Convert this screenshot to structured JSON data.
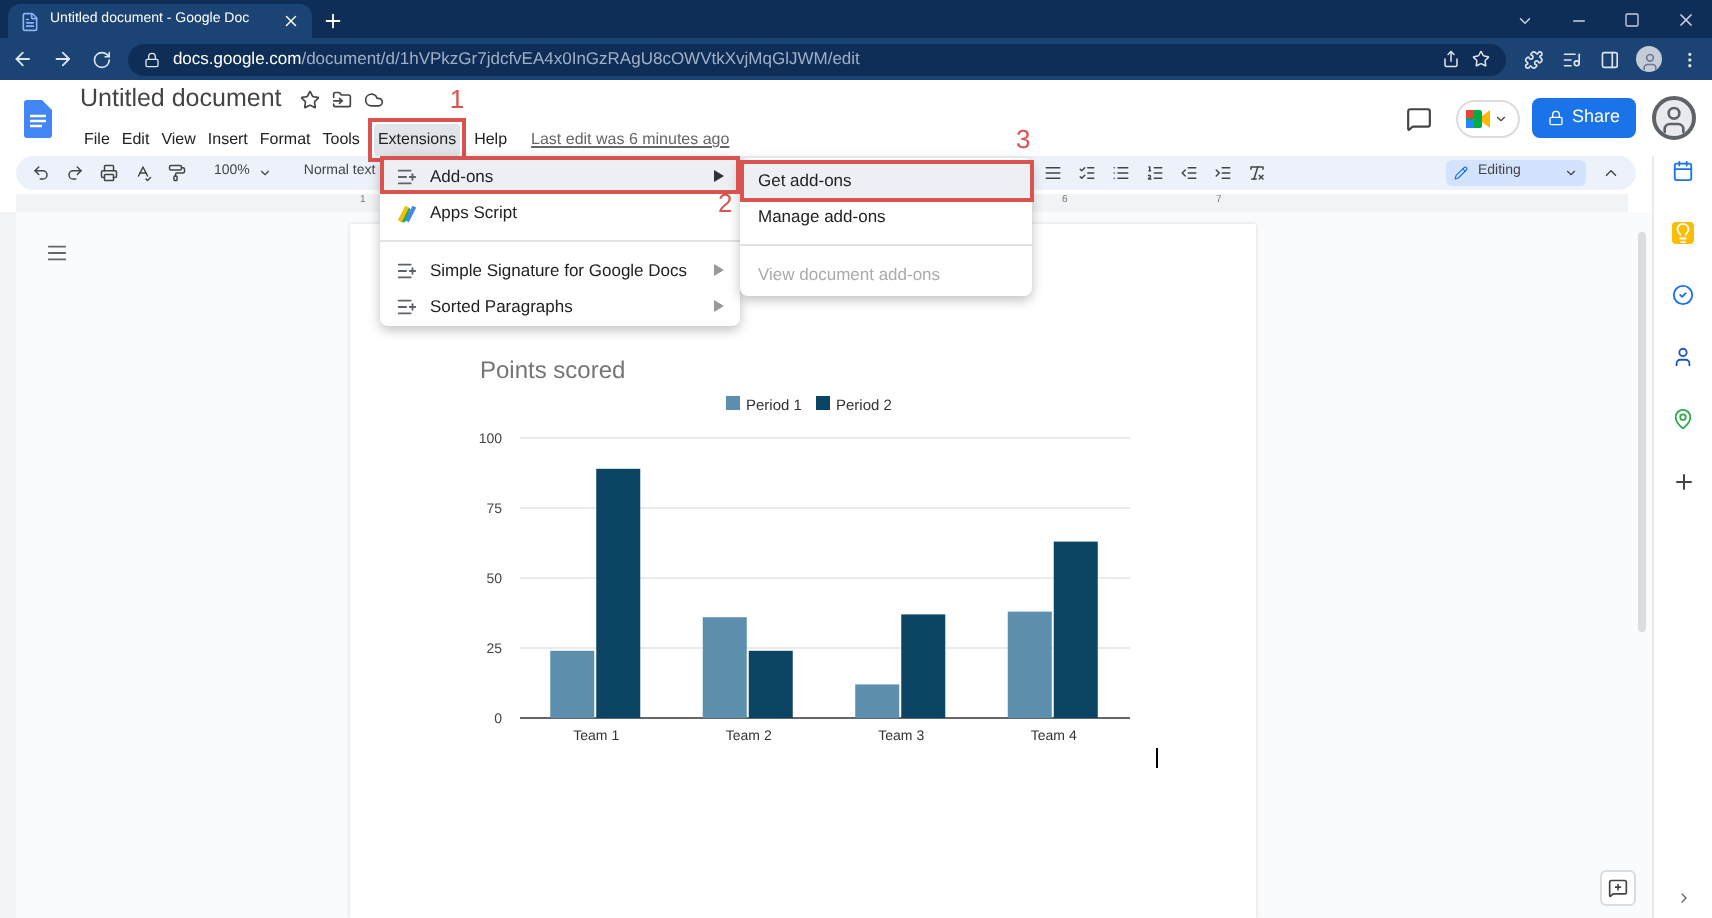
{
  "browser": {
    "tab_title": "Untitled document - Google Doc",
    "url": {
      "host": "docs.google.com",
      "path": "/document/d/1hVPkzGr7jdcfvEA4x0InGzRAgU8cOWVtkXvjMqGlJWM/edit"
    }
  },
  "document": {
    "title": "Untitled document",
    "last_edit": "Last edit was 6 minutes ago"
  },
  "menu_bar": [
    {
      "label": "File",
      "selected": false
    },
    {
      "label": "Edit",
      "selected": false
    },
    {
      "label": "View",
      "selected": false
    },
    {
      "label": "Insert",
      "selected": false
    },
    {
      "label": "Format",
      "selected": false
    },
    {
      "label": "Tools",
      "selected": false
    },
    {
      "label": "Extensions",
      "selected": true
    },
    {
      "label": "Help",
      "selected": false
    }
  ],
  "share_button": "Share",
  "toolbar": {
    "zoom": "100%",
    "style": "Normal text",
    "mode": "Editing"
  },
  "ruler": [
    "1",
    "6",
    "7"
  ],
  "extensions_menu": [
    {
      "kind": "addon",
      "label": "Add-ons",
      "has_submenu": true,
      "selected": true
    },
    {
      "kind": "script",
      "label": "Apps Script",
      "has_submenu": false,
      "selected": false
    },
    {
      "kind": "separator"
    },
    {
      "kind": "addon",
      "label": "Simple Signature for Google Docs",
      "has_submenu": true,
      "selected": false
    },
    {
      "kind": "addon",
      "label": "Sorted Paragraphs",
      "has_submenu": true,
      "selected": false
    }
  ],
  "addons_submenu": [
    {
      "kind": "item",
      "label": "Get add-ons",
      "selected": true,
      "disabled": false
    },
    {
      "kind": "item",
      "label": "Manage add-ons",
      "selected": false,
      "disabled": false
    },
    {
      "kind": "separator"
    },
    {
      "kind": "item",
      "label": "View document add-ons",
      "selected": false,
      "disabled": true
    }
  ],
  "annotations": [
    "1",
    "2",
    "3"
  ],
  "chart_data": {
    "type": "bar",
    "title": "Points scored",
    "categories": [
      "Team 1",
      "Team 2",
      "Team 3",
      "Team 4"
    ],
    "series": [
      {
        "name": "Period 1",
        "color": "#5b8fad",
        "values": [
          24,
          36,
          12,
          38
        ]
      },
      {
        "name": "Period 2",
        "color": "#0b4563",
        "values": [
          89,
          24,
          37,
          63
        ]
      }
    ],
    "ylim": [
      0,
      100
    ],
    "yticks": [
      0,
      25,
      50,
      75,
      100
    ],
    "grid": true,
    "legend": "top"
  }
}
